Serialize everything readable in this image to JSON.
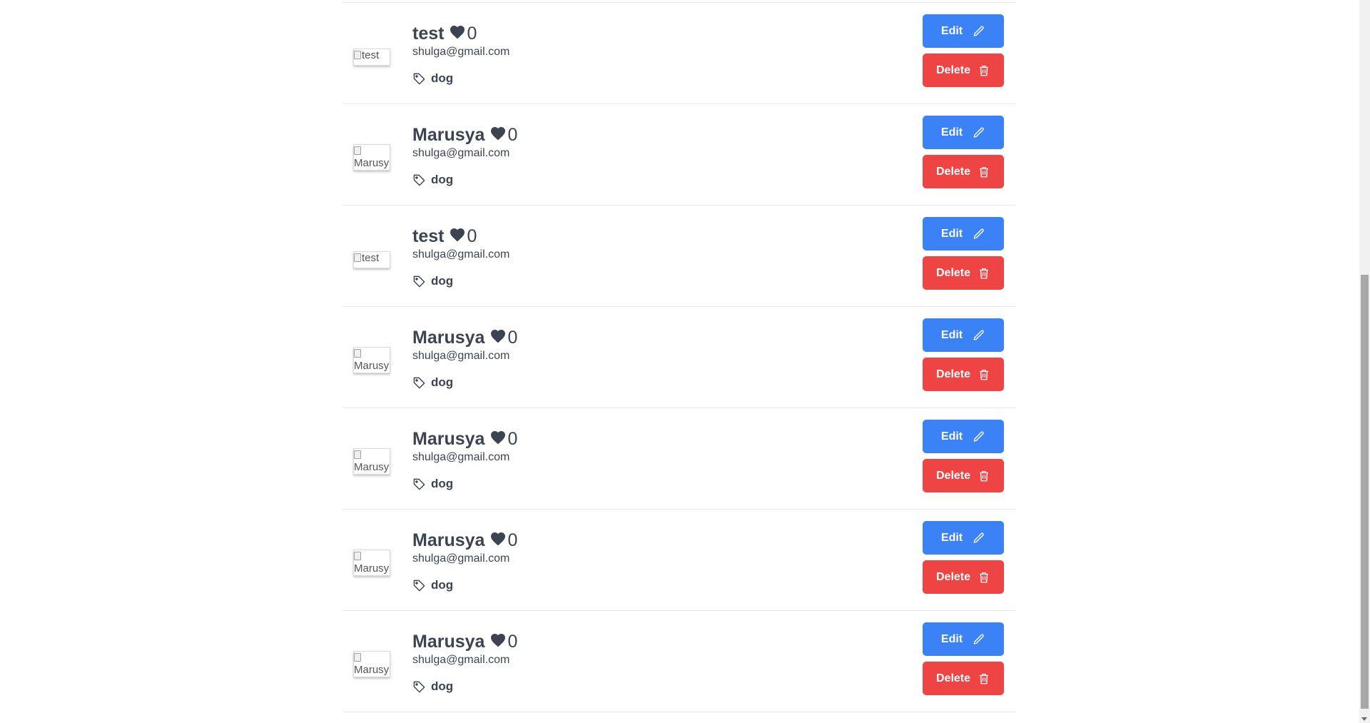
{
  "pets": [
    {
      "name": "test",
      "likes": "0",
      "email": "shulga@gmail.com",
      "tag": "dog",
      "image_alt": "test",
      "edit_label": "Edit",
      "delete_label": "Delete"
    },
    {
      "name": "Marusya",
      "likes": "0",
      "email": "shulga@gmail.com",
      "tag": "dog",
      "image_alt": "Marusy",
      "edit_label": "Edit",
      "delete_label": "Delete"
    },
    {
      "name": "test",
      "likes": "0",
      "email": "shulga@gmail.com",
      "tag": "dog",
      "image_alt": "test",
      "edit_label": "Edit",
      "delete_label": "Delete"
    },
    {
      "name": "Marusya",
      "likes": "0",
      "email": "shulga@gmail.com",
      "tag": "dog",
      "image_alt": "Marusy",
      "edit_label": "Edit",
      "delete_label": "Delete"
    },
    {
      "name": "Marusya",
      "likes": "0",
      "email": "shulga@gmail.com",
      "tag": "dog",
      "image_alt": "Marusy",
      "edit_label": "Edit",
      "delete_label": "Delete"
    },
    {
      "name": "Marusya",
      "likes": "0",
      "email": "shulga@gmail.com",
      "tag": "dog",
      "image_alt": "Marusy",
      "edit_label": "Edit",
      "delete_label": "Delete"
    },
    {
      "name": "Marusya",
      "likes": "0",
      "email": "shulga@gmail.com",
      "tag": "dog",
      "image_alt": "Marusy",
      "edit_label": "Edit",
      "delete_label": "Delete"
    }
  ],
  "icons": {
    "like": "heart-icon",
    "tag": "tag-icon",
    "edit": "pencil-icon",
    "delete": "trash-icon"
  },
  "colors": {
    "edit_button": "#3b82f6",
    "delete_button": "#ef4444",
    "text": "#3d4451",
    "divider": "#e5e7eb"
  }
}
